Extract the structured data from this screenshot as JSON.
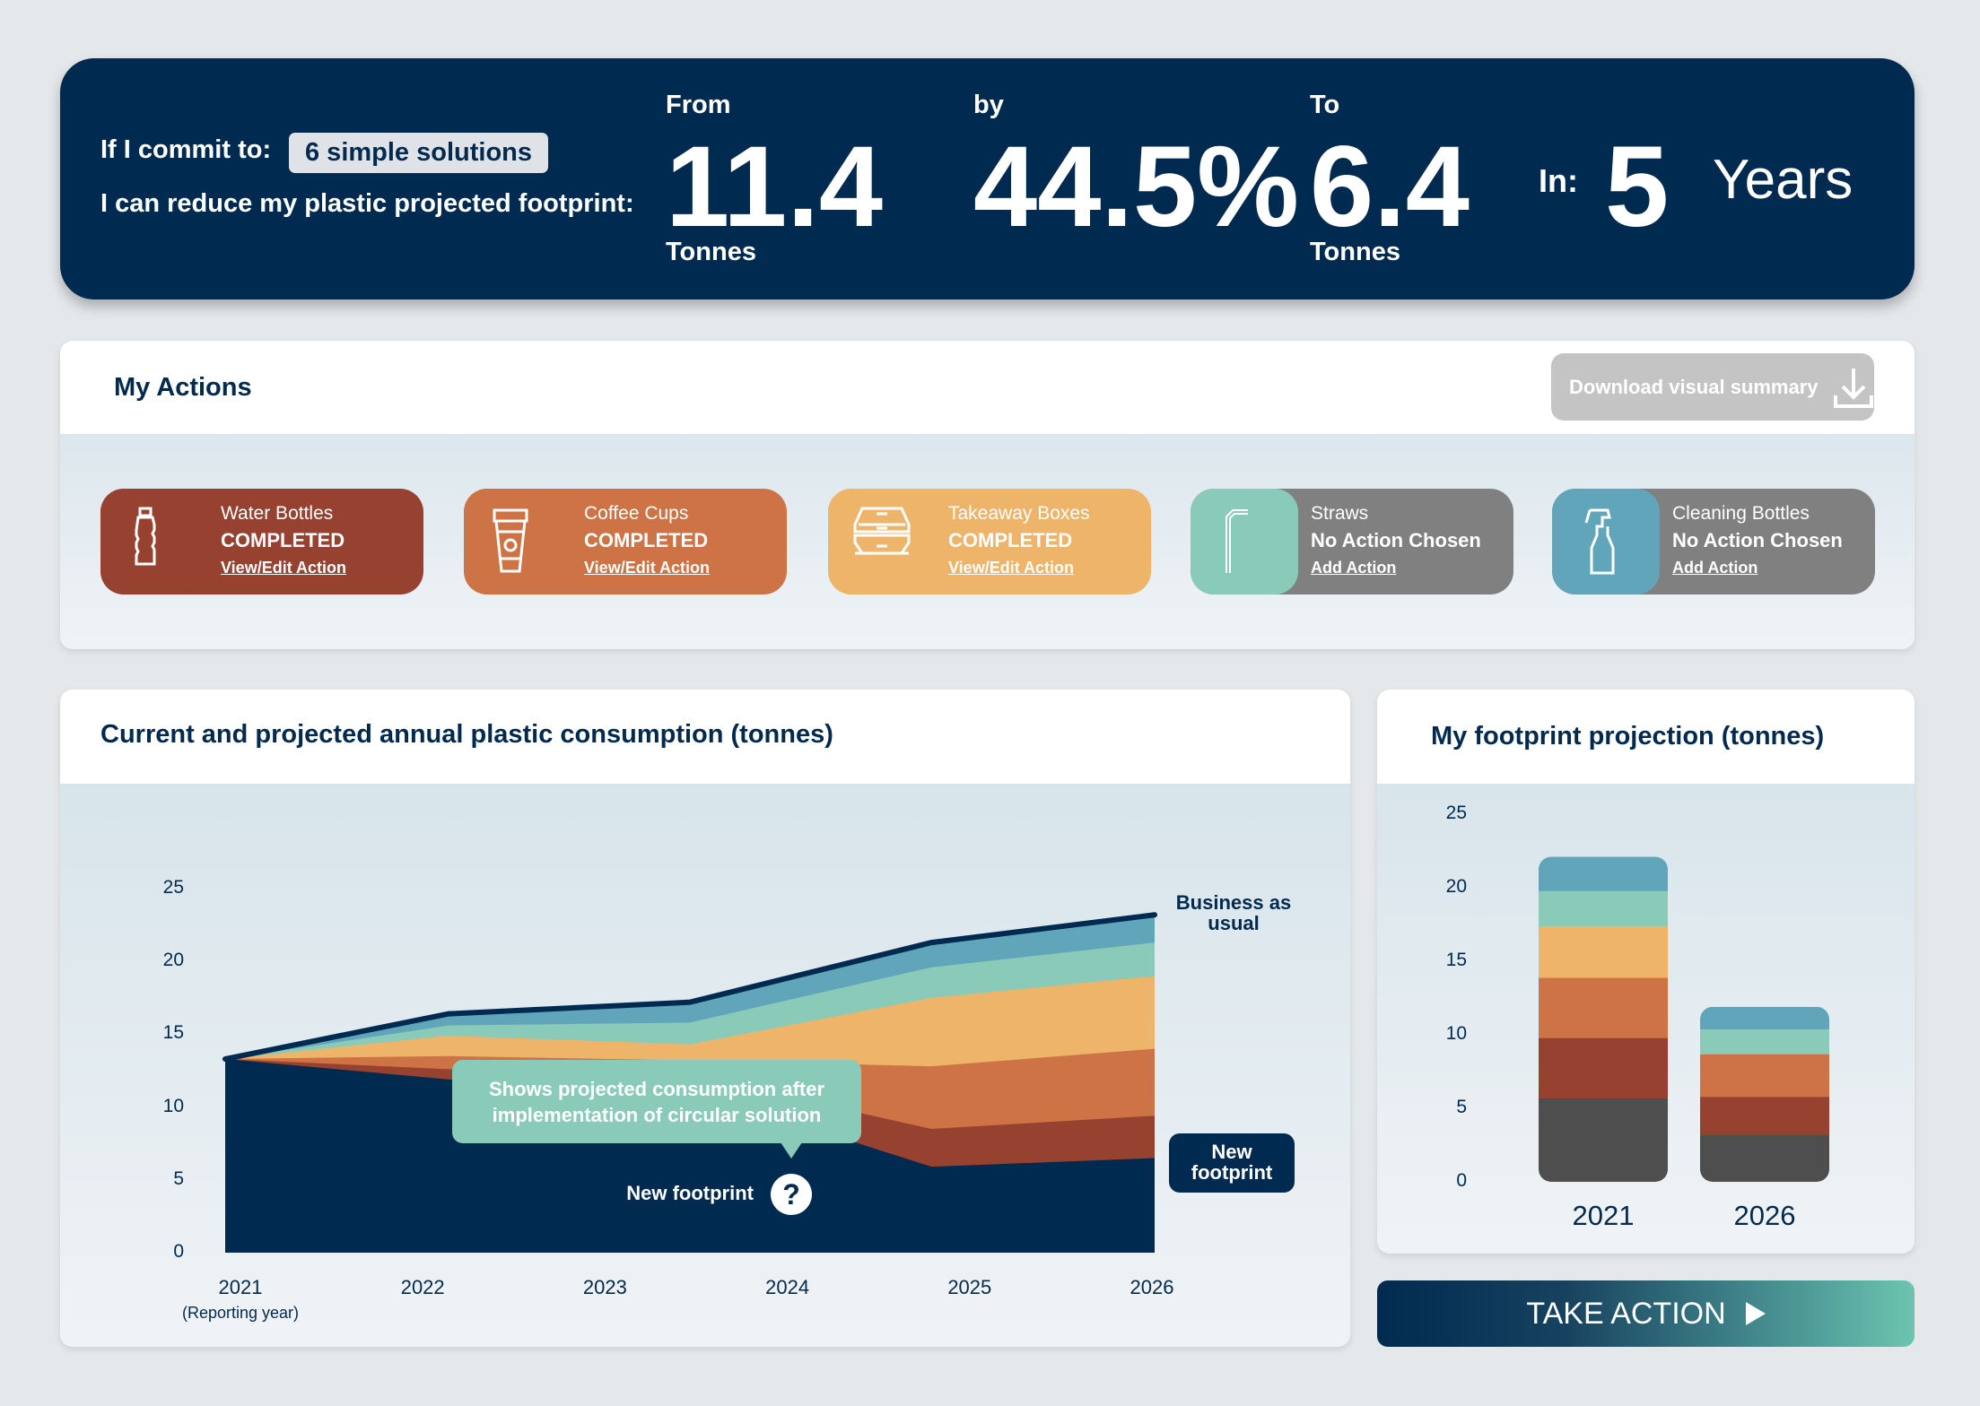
{
  "header": {
    "commit_label": "If I commit to:",
    "commit_value": "6 simple solutions",
    "reduce_label": "I can reduce my plastic projected footprint:",
    "from_label": "From",
    "from_value": "11.4",
    "from_unit": "Tonnes",
    "by_label": "by",
    "by_value": "44.5%",
    "to_label": "To",
    "to_value": "6.4",
    "to_unit": "Tonnes",
    "in_label": "In:",
    "in_value": "5",
    "in_unit": "Years"
  },
  "actions": {
    "title": "My Actions",
    "download_label": "Download visual summary",
    "items": [
      {
        "name": "Water Bottles",
        "status": "COMPLETED",
        "link": "View/Edit Action",
        "icon": "water-bottle-icon",
        "color": "#974131"
      },
      {
        "name": "Coffee Cups",
        "status": "COMPLETED",
        "link": "View/Edit Action",
        "icon": "coffee-cup-icon",
        "color": "#cd7345"
      },
      {
        "name": "Takeaway Boxes",
        "status": "COMPLETED",
        "link": "View/Edit Action",
        "icon": "takeaway-box-icon",
        "color": "#eeb46a"
      },
      {
        "name": "Straws",
        "status": "No Action Chosen",
        "link": "Add Action",
        "icon": "straw-icon",
        "color": "#89cab8"
      },
      {
        "name": "Cleaning Bottles",
        "status": "No Action Chosen",
        "link": "Add Action",
        "icon": "spray-bottle-icon",
        "color": "#61a5bb"
      }
    ]
  },
  "area_chart": {
    "title": "Current and projected annual plastic consumption (tonnes)"
  },
  "bar_chart": {
    "title": "My footprint projection (tonnes)"
  },
  "take_action": {
    "label": "TAKE ACTION"
  },
  "chart_data": [
    {
      "type": "area",
      "title": "Current and projected annual plastic consumption (tonnes)",
      "x_ticks": [
        "2021",
        "2022",
        "2023",
        "2024",
        "2025",
        "2026"
      ],
      "x_sub": "(Reporting year)",
      "y_ticks": [
        "0",
        "5",
        "10",
        "15",
        "20",
        "25"
      ],
      "ylim": [
        0,
        25
      ],
      "x": [
        2021,
        2022.2,
        2023.5,
        2024.8,
        2026
      ],
      "layers_cumulative_top": [
        {
          "color": "#002a4f",
          "values": [
            13.3,
            11.9,
            11.2,
            5.9,
            6.5
          ]
        },
        {
          "color": "#974131",
          "values": [
            13.3,
            12.6,
            12.2,
            8.5,
            9.4
          ]
        },
        {
          "color": "#cd7345",
          "values": [
            13.3,
            13.5,
            13.2,
            12.8,
            14.0
          ]
        },
        {
          "color": "#eeb46a",
          "values": [
            13.3,
            14.9,
            14.3,
            17.5,
            19.0
          ]
        },
        {
          "color": "#89cab8",
          "values": [
            13.3,
            15.6,
            15.8,
            19.6,
            21.3
          ]
        },
        {
          "color": "#61a5bb",
          "values": [
            13.3,
            16.4,
            17.2,
            21.3,
            23.2
          ]
        }
      ],
      "annotations": {
        "bau": "Business as usual",
        "new_badge": "New footprint",
        "new_inline": "New footprint",
        "tooltip": "Shows projected consumption after implementation of circular solution"
      }
    },
    {
      "type": "bar",
      "stacked": true,
      "title": "My footprint projection (tonnes)",
      "categories": [
        "2021",
        "2026"
      ],
      "y_ticks": [
        "0",
        "5",
        "10",
        "15",
        "20",
        "25"
      ],
      "ylim": [
        0,
        25
      ],
      "series": [
        {
          "color": "#4e4e4e",
          "values": [
            5.7,
            3.2
          ]
        },
        {
          "color": "#974131",
          "values": [
            4.1,
            2.6
          ]
        },
        {
          "color": "#cd7345",
          "values": [
            4.1,
            2.9
          ]
        },
        {
          "color": "#eeb46a",
          "values": [
            3.5,
            0
          ]
        },
        {
          "color": "#89cab8",
          "values": [
            2.4,
            1.7
          ]
        },
        {
          "color": "#61a5bb",
          "values": [
            2.3,
            1.5
          ]
        }
      ]
    }
  ]
}
